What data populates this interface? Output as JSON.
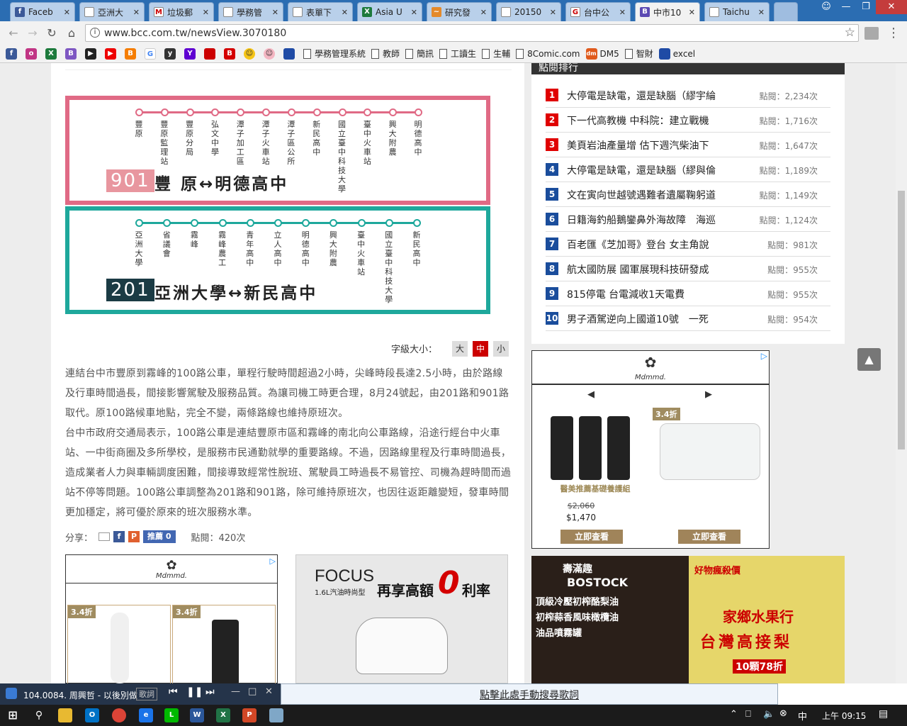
{
  "browser": {
    "tabs": [
      {
        "title": "Faceb",
        "fav_color": "#3b5998",
        "fav_glyph": "f"
      },
      {
        "title": "亞洲大",
        "fav_color": "#ffffff",
        "fav_glyph": ""
      },
      {
        "title": "垃圾郵",
        "fav_color": "#ffffff",
        "fav_glyph": "M"
      },
      {
        "title": "學務管",
        "fav_color": "#ffffff",
        "fav_glyph": ""
      },
      {
        "title": "表單下",
        "fav_color": "#ffffff",
        "fav_glyph": ""
      },
      {
        "title": "Asia U",
        "fav_color": "#1d7a3c",
        "fav_glyph": "X"
      },
      {
        "title": "研究發",
        "fav_color": "#e48a2b",
        "fav_glyph": "~"
      },
      {
        "title": "20150",
        "fav_color": "#ffffff",
        "fav_glyph": ""
      },
      {
        "title": "台中公",
        "fav_color": "#ffffff",
        "fav_glyph": "G"
      },
      {
        "title": "中市10",
        "fav_color": "#5c4ab3",
        "fav_glyph": "B"
      },
      {
        "title": "Taichu",
        "fav_color": "#ffffff",
        "fav_glyph": ""
      }
    ],
    "url": "www.bcc.com.tw/newsView.3070180",
    "bookmarks": [
      "學務管理系統",
      "教師",
      "簡訊",
      "工讀生",
      "生輔",
      "8Comic.com",
      "DM5",
      "智財",
      "excel"
    ]
  },
  "busmap": {
    "route1": {
      "number": "901",
      "name": "豐 原↔明德高中",
      "color": "#e06a85",
      "stops": [
        "豐原",
        "豐原監理站",
        "豐原分局",
        "弘文中學",
        "潭子加工區",
        "潭子火車站",
        "潭子區公所",
        "新民高中",
        "國立臺中科技大學",
        "臺中火車站",
        "興大附農",
        "明德高中"
      ]
    },
    "route2": {
      "number": "201",
      "name": "亞洲大學↔新民高中",
      "color": "#1ea89c",
      "stops": [
        "亞洲大學",
        "省議會",
        "霧峰",
        "霧峰農工",
        "青年高中",
        "立人高中",
        "明德高中",
        "興大附農",
        "臺中火車站",
        "國立臺中科技大學",
        "新民高中"
      ]
    }
  },
  "fontsize": {
    "label": "字級大小：",
    "options": [
      "大",
      "中",
      "小"
    ],
    "selected": "中"
  },
  "article": {
    "p1": "連結台中市豐原到霧峰的100路公車，單程行駛時間超過2小時，尖峰時段長達2.5小時，由於路線及行車時間過長，間接影響駕駛及服務品質。為讓司機工時更合理，8月24號起，由201路和901路取代。原100路候車地點，完全不變，兩條路線也維持原班次。",
    "p2": "台中市政府交通局表示，100路公車是連結豐原市區和霧峰的南北向公車路線，沿途行經台中火車站、一中街商圈及多所學校，是服務市民通勤就學的重要路線。不過，因路線里程及行車時間過長，造成業者人力與車輛調度困難，間接導致經常性脫班、駕駛員工時過長不易管控、司機為趕時間而過站不停等問題。100路公車調整為201路和901路，除可維持原班次，也因往返距離變短，發車時間更加穩定，將可優於原來的班次服務水準。"
  },
  "share": {
    "label": "分享：",
    "like_label": "推薦 0",
    "views": "點閱：420次"
  },
  "popular": {
    "title": "點閱排行",
    "items": [
      {
        "rank": "1",
        "title": "大停電是缺電，還是缺腦（繆宇綸",
        "count": "點閱：2,234次",
        "color": "#e00000"
      },
      {
        "rank": "2",
        "title": "下一代高教機 中科院：建立戰機",
        "count": "點閱：1,716次",
        "color": "#e00000"
      },
      {
        "rank": "3",
        "title": "美頁岩油產量增 估下週汽柴油下",
        "count": "點閱：1,647次",
        "color": "#e00000"
      },
      {
        "rank": "4",
        "title": "大停電是缺電，還是缺腦（繆與倫",
        "count": "點閱：1,189次",
        "color": "#1a4d9c"
      },
      {
        "rank": "5",
        "title": "文在寅向世越號遇難者遺屬鞠躬道",
        "count": "點閱：1,149次",
        "color": "#1a4d9c"
      },
      {
        "rank": "6",
        "title": "日籍海釣船鵝鑾鼻外海故障　海巡",
        "count": "點閱：1,124次",
        "color": "#1a4d9c"
      },
      {
        "rank": "7",
        "title": "百老匯《芝加哥》登台 女主角說",
        "count": "點閱：981次",
        "color": "#1a4d9c"
      },
      {
        "rank": "8",
        "title": "航太國防展 國軍展現科技研發成",
        "count": "點閱：955次",
        "color": "#1a4d9c"
      },
      {
        "rank": "9",
        "title": "815停電 台電減收1天電費",
        "count": "點閱：955次",
        "color": "#1a4d9c"
      },
      {
        "rank": "10",
        "title": "男子酒駕逆向上國道10號　一死",
        "count": "點閱：954次",
        "color": "#1a4d9c"
      }
    ]
  },
  "ad_right": {
    "brand": "Mdmmd.",
    "discount": "3.4折",
    "product": "醫美推薦基礎養護組",
    "old_price": "$2,060",
    "new_price": "$1,470",
    "button": "立即查看"
  },
  "ad_left": {
    "brand": "Mdmmd.",
    "discount": "3.4折"
  },
  "ad_focus": {
    "brand": "FOCUS",
    "sub": "1.6L汽油時尚型",
    "promo": "再享高額",
    "zero": "0",
    "rate": "利率"
  },
  "ad_bostock": {
    "line0": "壽滿趣",
    "brand": "BOSTOCK",
    "l1": "頂級冷壓初榨酪梨油",
    "l2": "初榨蒜香風味橄欖油",
    "l3": "油品噴霧罐",
    "shop": "好物瘋殺價",
    "fruit": "家鄉水果行",
    "pear": "台灣高接梨",
    "deal": "10顆78折"
  },
  "lyric": {
    "player": "104.0084. 周興哲 - 以後別做",
    "tag": "歌詞",
    "search": "點擊此處手動搜尋歌詞"
  },
  "taskbar": {
    "time": "上午 09:15"
  }
}
